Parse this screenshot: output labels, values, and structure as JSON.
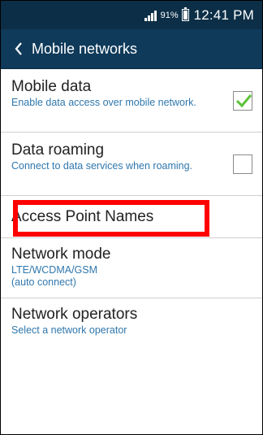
{
  "status_bar": {
    "battery_percent": "91%",
    "battery_level": 0.91,
    "time": "12:41 PM",
    "icons": [
      "signal-icon",
      "battery-icon"
    ]
  },
  "action_bar": {
    "back_icon": "chevron-left-icon",
    "title": "Mobile networks"
  },
  "settings": {
    "mobile_data": {
      "title": "Mobile data",
      "summary": "Enable data access over mobile network.",
      "checked": true
    },
    "data_roaming": {
      "title": "Data roaming",
      "summary": "Connect to data services when roaming.",
      "checked": false
    },
    "access_point_names": {
      "title": "Access Point Names"
    },
    "network_mode": {
      "title": "Network mode",
      "summary_line1": "LTE/WCDMA/GSM",
      "summary_line2": "(auto connect)"
    },
    "network_operators": {
      "title": "Network operators",
      "summary": "Select a network operator"
    }
  },
  "colors": {
    "status_bar_bg": "#0c2f47",
    "action_bar_bg": "#0f3a5a",
    "summary_text": "#2f77ad",
    "check_mark": "#5cc33a",
    "highlight": "#ff0000"
  }
}
